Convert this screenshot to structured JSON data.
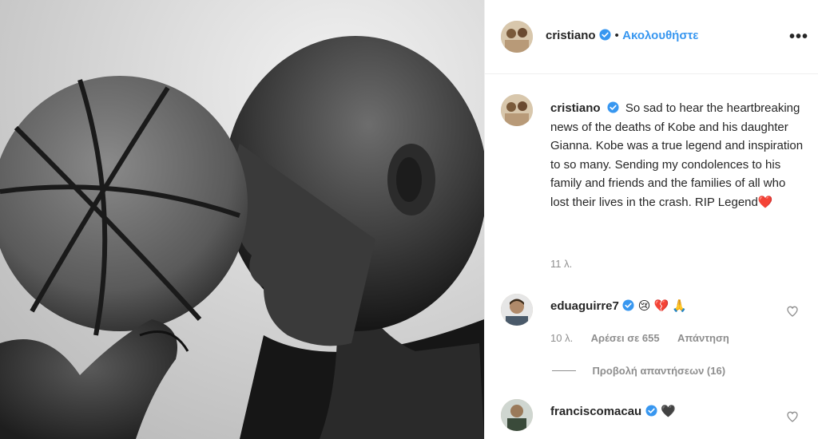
{
  "post": {
    "author": "cristiano",
    "follow_separator": "•",
    "follow_label": "Ακολουθήστε",
    "more_label": "•••",
    "caption": "So sad to hear the heartbreaking news of the deaths of Kobe and his daughter Gianna. Kobe was a true legend and inspiration to so many. Sending my condolences to his family and friends and the families of all who lost their lives in the crash. RIP Legend",
    "caption_emoji": "❤️",
    "caption_time": "11 λ."
  },
  "comments": [
    {
      "author": "eduaguirre7",
      "text": "😢 💔 🙏",
      "time": "10 λ.",
      "likes_label": "Αρέσει σε 655",
      "reply_label": "Απάντηση",
      "view_replies_label": "Προβολή απαντήσεων (16)"
    },
    {
      "author": "franciscomacau",
      "text": "🖤"
    }
  ],
  "icons": {
    "verified": "verified-badge-icon",
    "heart": "heart-outline-icon",
    "more": "more-options-icon"
  },
  "colors": {
    "accent": "#3897f0",
    "text": "#262626",
    "muted": "#8e8e8e",
    "border": "#efefef"
  }
}
